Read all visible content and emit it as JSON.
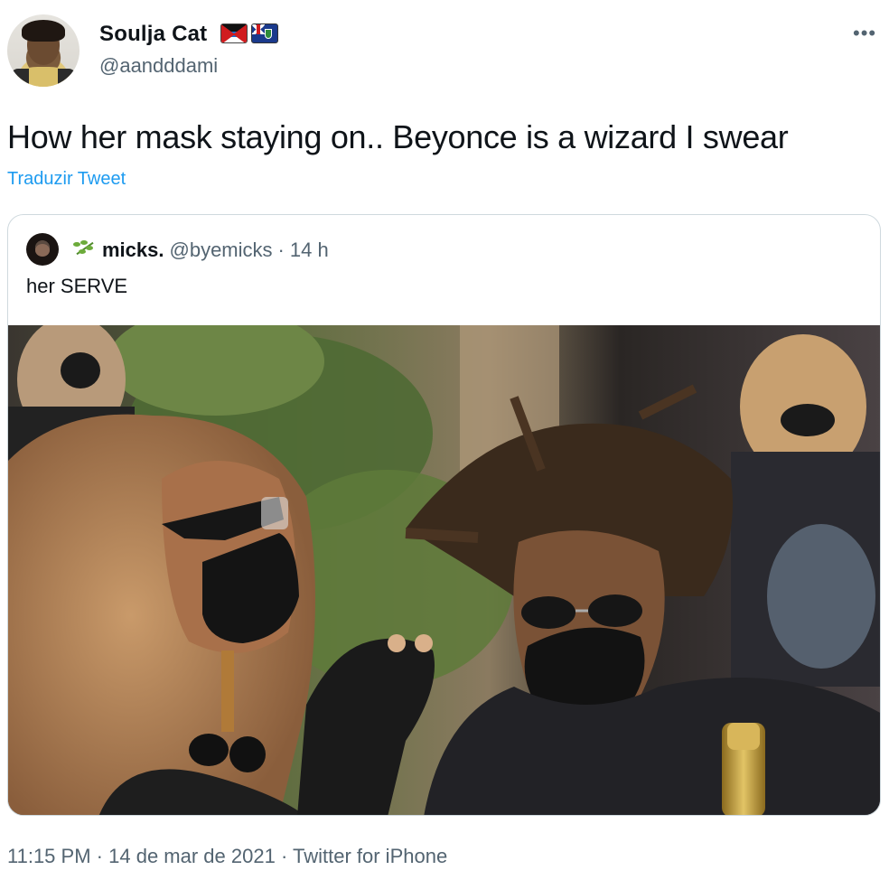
{
  "author": {
    "display_name": "Soulja Cat",
    "handle": "@aandddami",
    "flags": [
      "antigua-barbuda-flag",
      "british-virgin-islands-flag"
    ]
  },
  "tweet": {
    "text": "How her mask staying on.. Beyonce is a wizard I swear",
    "translate_label": "Traduzir Tweet"
  },
  "quoted_tweet": {
    "display_name": "micks.",
    "handle": "@byemicks",
    "separator": "·",
    "time": "14 h",
    "text": "her SERVE"
  },
  "footer": {
    "time": "11:15 PM",
    "separator": "·",
    "date": "14 de mar de 2021",
    "source": "Twitter for iPhone"
  },
  "colors": {
    "link": "#1d9bf0",
    "secondary_text": "#536471",
    "border": "#cfd9de"
  }
}
